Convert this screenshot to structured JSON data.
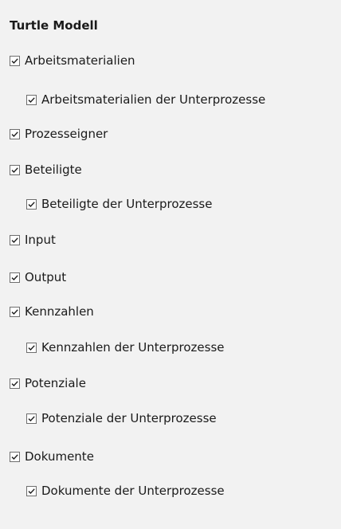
{
  "panel": {
    "title": "Turtle Modell",
    "items": [
      {
        "label": "Arbeitsmaterialien",
        "checked": true,
        "level": 0
      },
      {
        "label": "Arbeitsmaterialien der Unterprozesse",
        "checked": true,
        "level": 1
      },
      {
        "label": "Prozesseigner",
        "checked": true,
        "level": 0
      },
      {
        "label": "Beteiligte",
        "checked": true,
        "level": 0
      },
      {
        "label": "Beteiligte der Unterprozesse",
        "checked": true,
        "level": 1
      },
      {
        "label": "Input",
        "checked": true,
        "level": 0
      },
      {
        "label": "Output",
        "checked": true,
        "level": 0
      },
      {
        "label": "Kennzahlen",
        "checked": true,
        "level": 0
      },
      {
        "label": "Kennzahlen der Unterprozesse",
        "checked": true,
        "level": 1
      },
      {
        "label": "Potenziale",
        "checked": true,
        "level": 0
      },
      {
        "label": "Potenziale der Unterprozesse",
        "checked": true,
        "level": 1
      },
      {
        "label": "Dokumente",
        "checked": true,
        "level": 0
      },
      {
        "label": "Dokumente der Unterprozesse",
        "checked": true,
        "level": 1
      }
    ]
  },
  "colors": {
    "panel_background": "#f2f2f2",
    "checkbox_border": "#6e6e6e",
    "checkmark": "#1a1a1a"
  },
  "icons": {
    "checkbox": "checkbox-checked-icon"
  }
}
